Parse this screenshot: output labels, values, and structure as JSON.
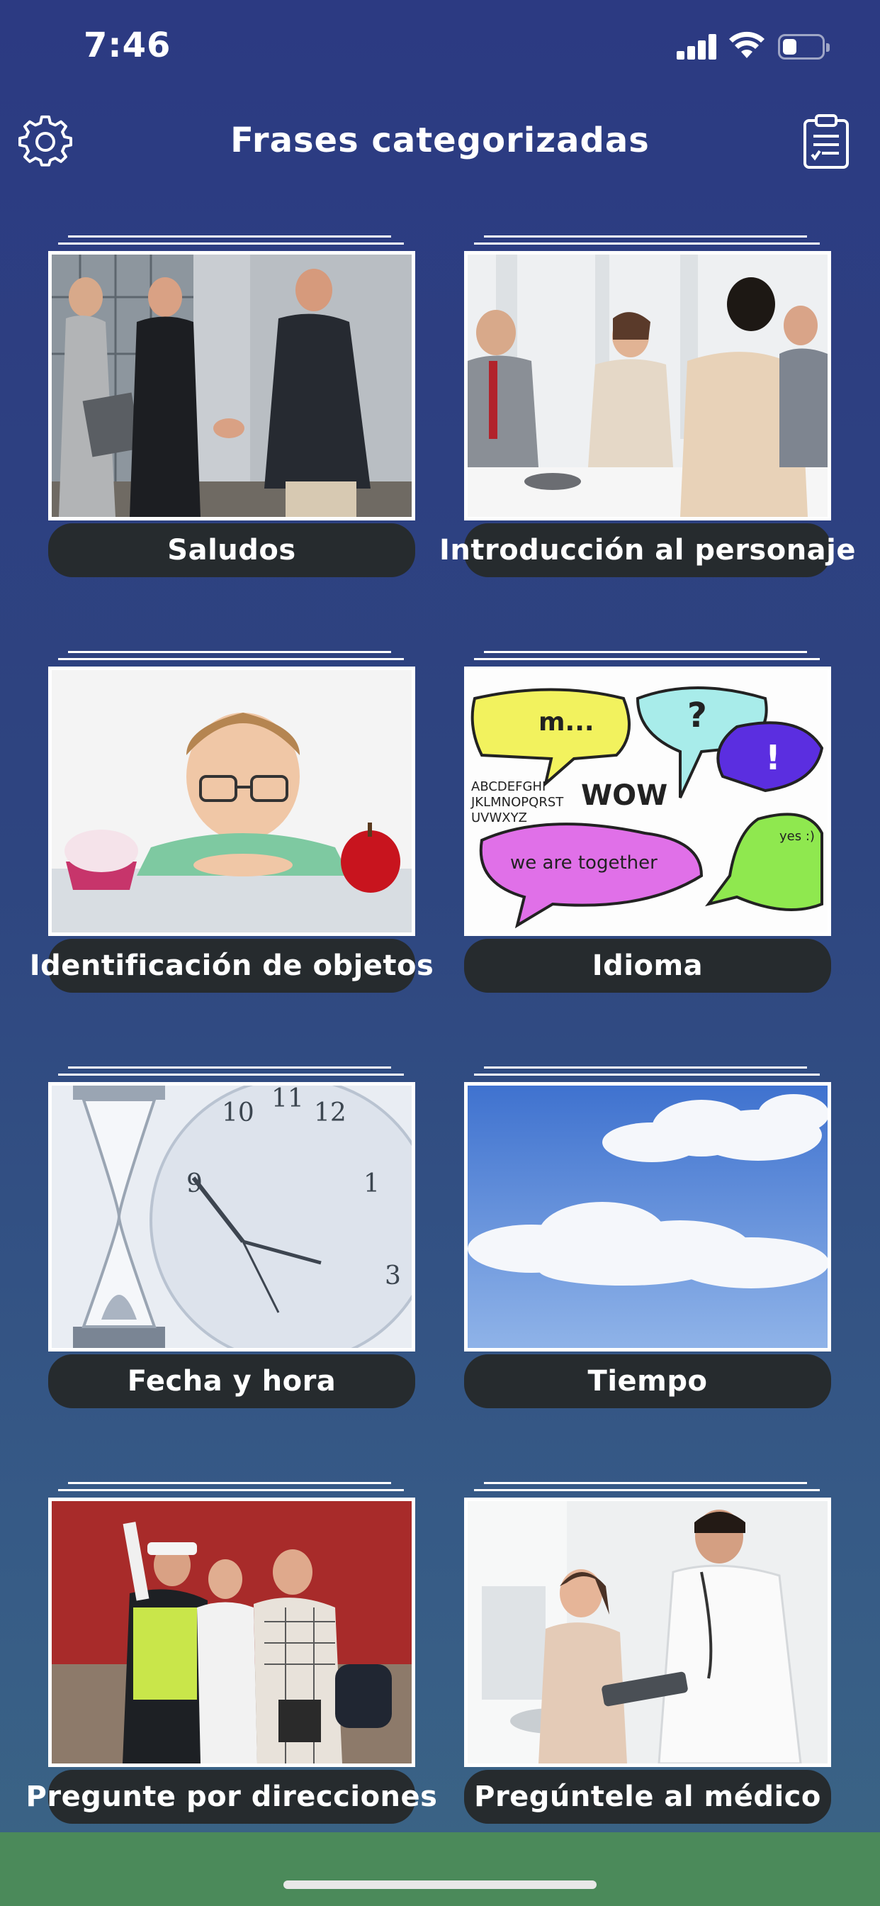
{
  "status": {
    "time": "7:46",
    "battery_level": 0.35
  },
  "nav": {
    "title": "Frases categorizadas",
    "settings_icon": "gear-icon",
    "clipboard_icon": "clipboard-icon"
  },
  "categories": [
    {
      "label": "Saludos",
      "image": "business-handshake"
    },
    {
      "label": "Introducción al personaje",
      "image": "office-meeting"
    },
    {
      "label": "Identificación de objetos",
      "image": "boy-cupcake-apple"
    },
    {
      "label": "Idioma",
      "image": "speech-bubbles"
    },
    {
      "label": "Fecha y hora",
      "image": "hourglass-clock"
    },
    {
      "label": "Tiempo",
      "image": "blue-sky-clouds"
    },
    {
      "label": "Pregunte por direcciones",
      "image": "traffic-police-tourists"
    },
    {
      "label": "Pregúntele al médico",
      "image": "doctor-patient"
    }
  ],
  "colors": {
    "background": "#2c3a82",
    "label_bg": "#262b2e",
    "bottom_bar": "#4b8a5a"
  }
}
